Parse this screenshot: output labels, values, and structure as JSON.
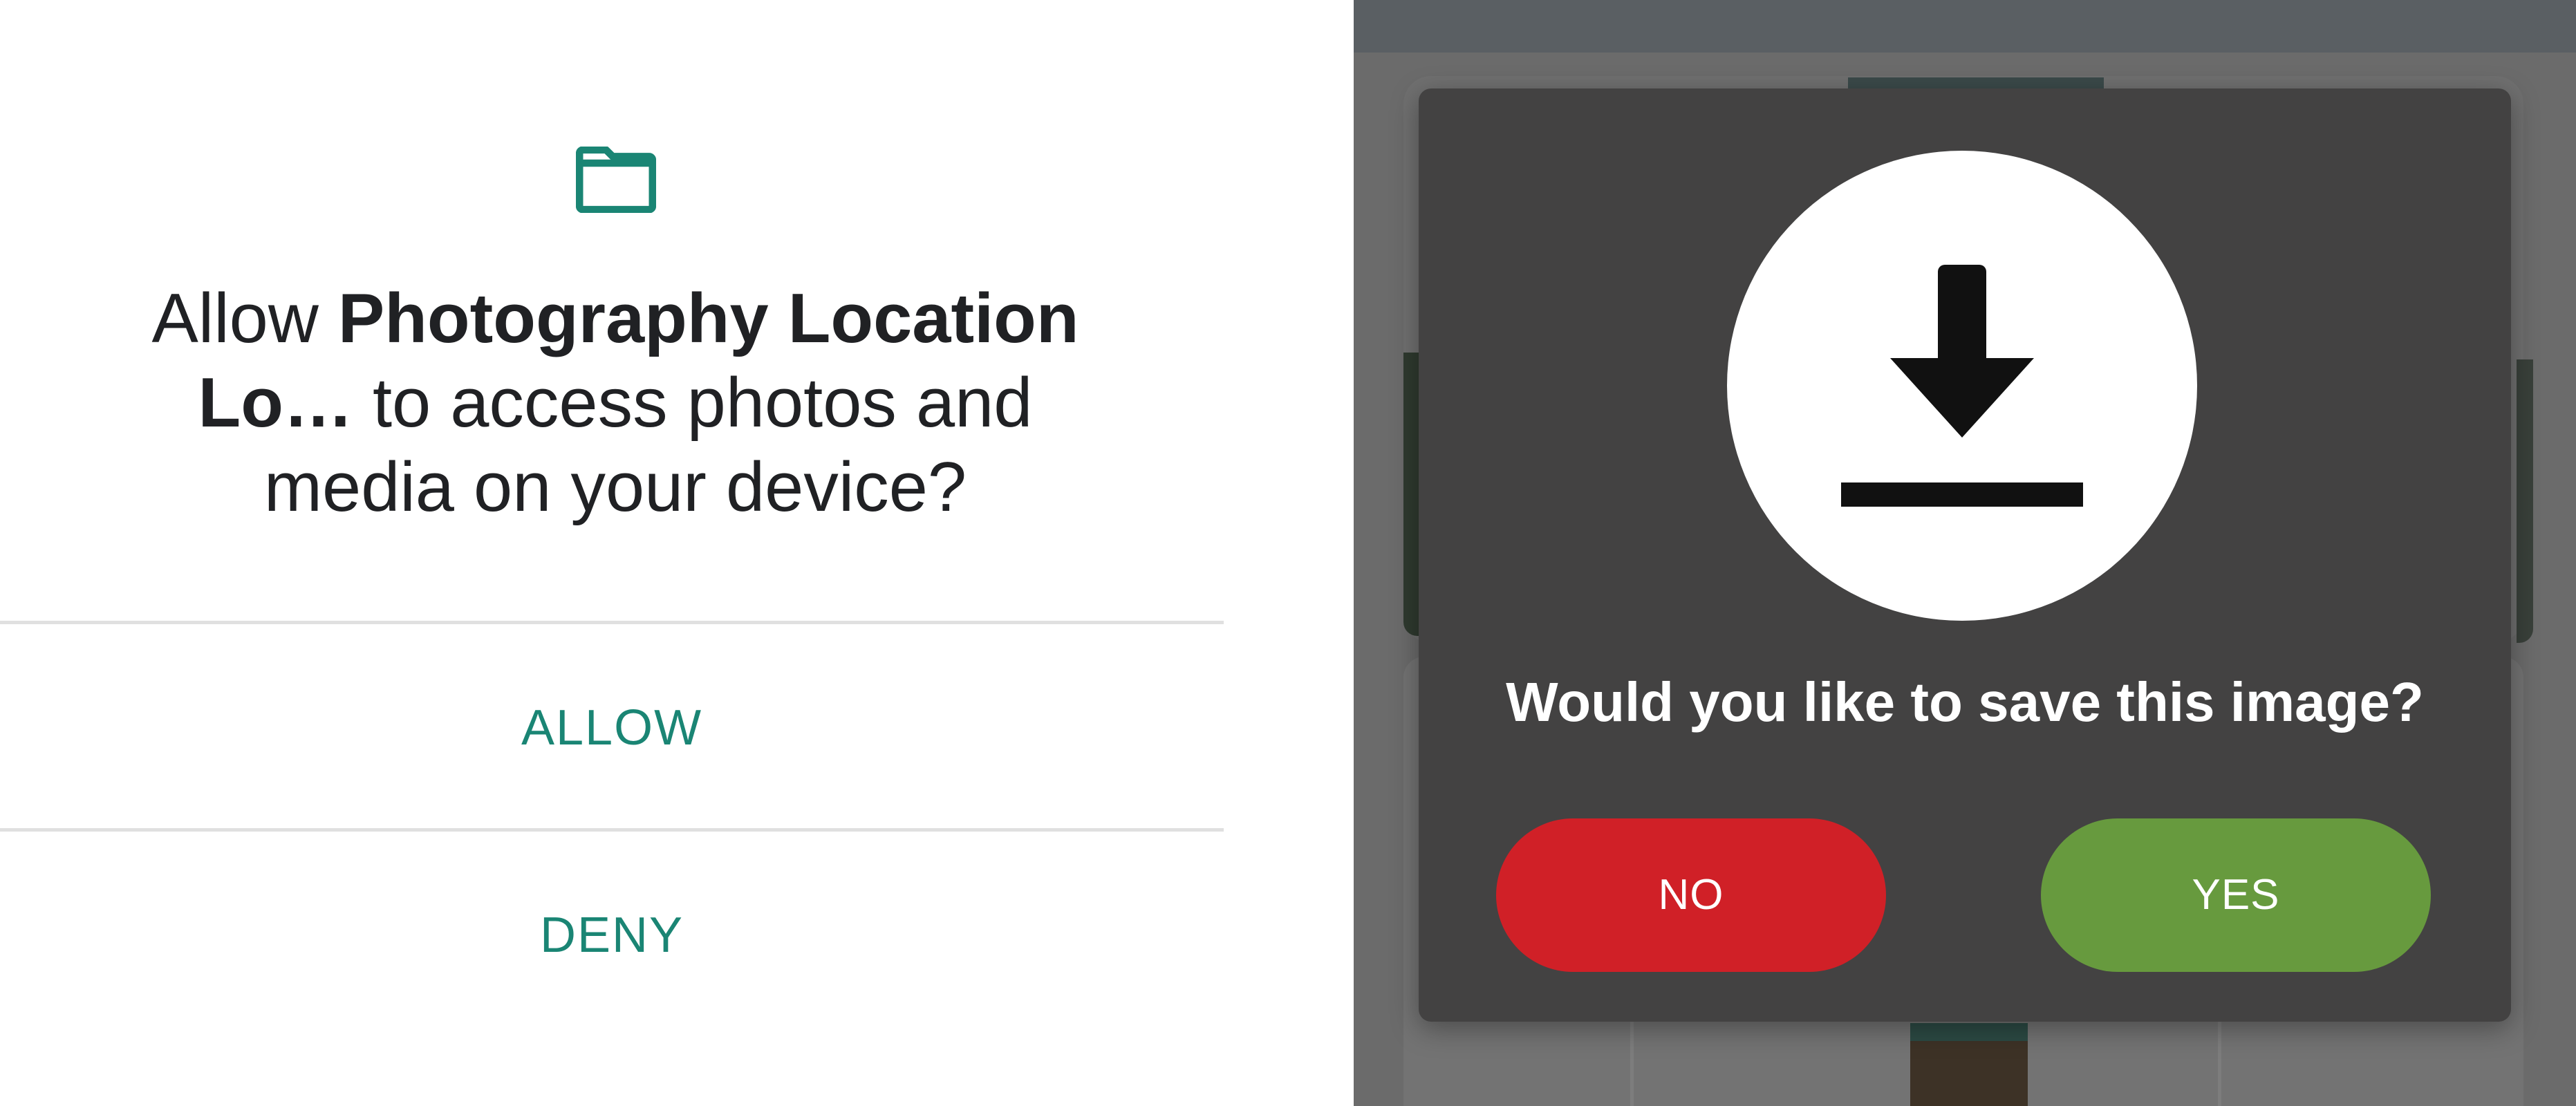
{
  "permission_dialog": {
    "icon": "folder-icon",
    "message_prefix": "Allow ",
    "app_name": "Photography Location Lo…",
    "message_suffix": " to access photos and media on your device?",
    "allow_label": "ALLOW",
    "deny_label": "DENY",
    "accent_color": "#1a8574"
  },
  "save_dialog": {
    "icon": "download-icon",
    "question": "Would you like to save this image?",
    "no_label": "NO",
    "yes_label": "YES",
    "no_color": "#d02027",
    "yes_color": "#679a3e"
  }
}
